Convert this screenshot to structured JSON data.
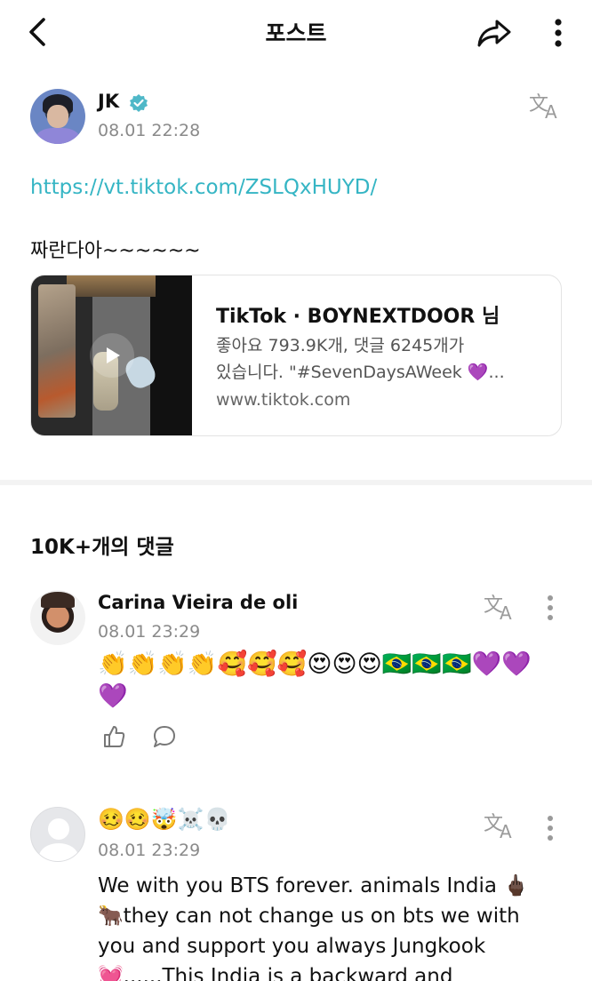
{
  "header": {
    "title": "포스트",
    "icons": [
      "back-arrow-icon",
      "share-icon",
      "more-vertical-icon"
    ]
  },
  "post": {
    "author": "JK",
    "verified": true,
    "timestamp": "08.01 22:28",
    "link_text": "https://vt.tiktok.com/ZSLQxHUYD/",
    "body": "짜란다아~~~~~~",
    "link_card": {
      "title": "TikTok · BOYNEXTDOOR 님",
      "description_line1": "좋아요 793.9K개, 댓글 6245개가",
      "description_line2": "있습니다. \"#SevenDaysAWeek 💜...",
      "domain": "www.tiktok.com"
    }
  },
  "comments_section": {
    "heading": "10K+개의 댓글",
    "comments": [
      {
        "name": "Carina Vieira de oli",
        "timestamp": "08.01 23:29",
        "body": "👏👏👏👏🥰🥰🥰😍😍😍🇧🇷🇧🇷🇧🇷💜💜💜"
      },
      {
        "name": "🥴🥴🤯☠️💀",
        "timestamp": "08.01 23:29",
        "body_line1": "We with you BTS forever. animals India 🖕🏿",
        "body_line2": "🐂they can not  change us on bts we with",
        "body_line3": "you and support you always Jungkook",
        "body_line4": "💓......This India is a backward and"
      }
    ]
  },
  "colors": {
    "link": "#35b5c4",
    "verified": "#4fb8c8",
    "muted_text": "#8a8a8a"
  }
}
